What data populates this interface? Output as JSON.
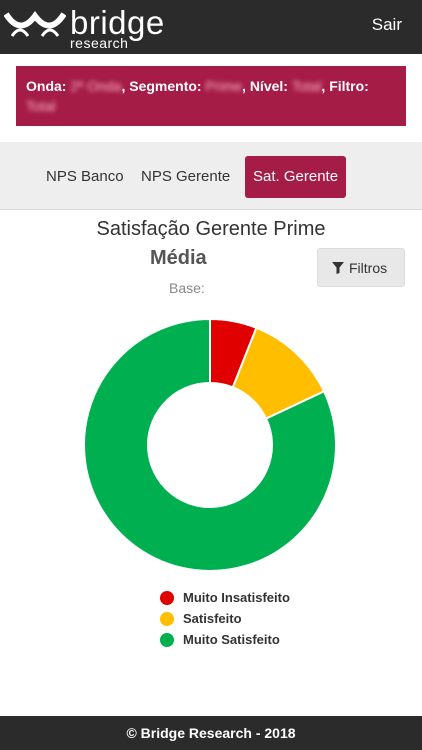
{
  "header": {
    "logo_text": "bridge",
    "logo_subtext": "research",
    "logout_label": "Sair"
  },
  "filters_summary": {
    "onda_label": "Onda:",
    "onda_value": "2ª Onda",
    "segmento_label": "Segmento:",
    "segmento_value": "Prime",
    "nivel_label": "Nível:",
    "nivel_value": "Total",
    "filtro_label": "Filtro:",
    "filtro_value": "Total"
  },
  "tabs": [
    {
      "label": "NPS Banco",
      "active": false
    },
    {
      "label": "NPS Gerente",
      "active": false
    },
    {
      "label": "Sat. Gerente",
      "active": true
    }
  ],
  "filters_button": {
    "label": "Filtros",
    "icon": "funnel-icon"
  },
  "colors": {
    "brand": "#a51c46",
    "muito_insatisfeito": "#e00000",
    "satisfeito": "#ffbf00",
    "muito_satisfeito": "#00b050"
  },
  "chart_data": {
    "type": "pie",
    "donut": true,
    "title": "Satisfação Gerente Prime",
    "subtitle": "Média",
    "base_label": "Base:",
    "legend_position": "bottom",
    "series": [
      {
        "name": "Muito Insatisfeito",
        "value": 6,
        "color": "#e00000"
      },
      {
        "name": "Satisfeito",
        "value": 12,
        "color": "#ffbf00"
      },
      {
        "name": "Muito Satisfeito",
        "value": 82,
        "color": "#00b050"
      }
    ]
  },
  "footer": {
    "text": "© Bridge Research - 2018"
  }
}
